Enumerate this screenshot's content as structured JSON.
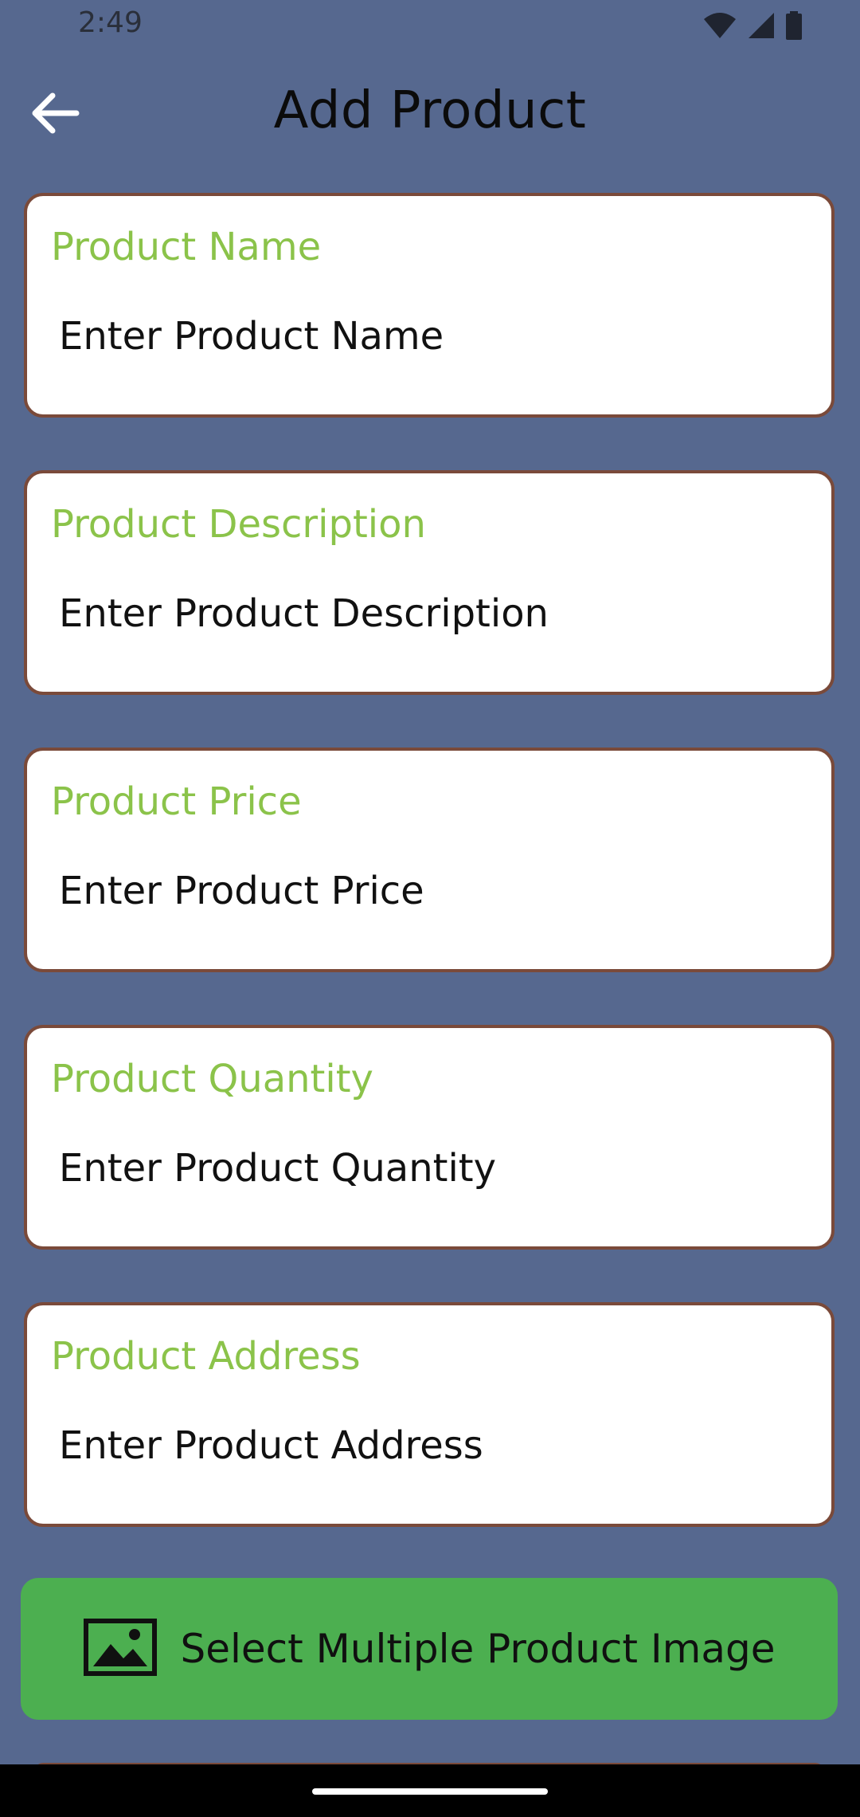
{
  "status_bar": {
    "time": "2:49",
    "icons": [
      "wifi-icon",
      "signal-icon",
      "battery-icon"
    ]
  },
  "app_bar": {
    "title": "Add Product",
    "back_icon": "arrow-back-icon"
  },
  "fields": {
    "name": {
      "label": "Product Name",
      "placeholder": "Enter Product Name"
    },
    "description": {
      "label": "Product Description",
      "placeholder": "Enter Product Description"
    },
    "price": {
      "label": "Product Price",
      "placeholder": "Enter Product Price"
    },
    "quantity": {
      "label": "Product Quantity",
      "placeholder": "Enter Product Quantity"
    },
    "address": {
      "label": "Product Address",
      "placeholder": "Enter Product Address"
    }
  },
  "select_image_button": {
    "label": "Select Multiple Product Image",
    "icon": "image-icon"
  },
  "colors": {
    "background": "#56688f",
    "label_green": "#8bc34a",
    "button_green": "#4caf50",
    "card_border": "#7a4a3a"
  }
}
